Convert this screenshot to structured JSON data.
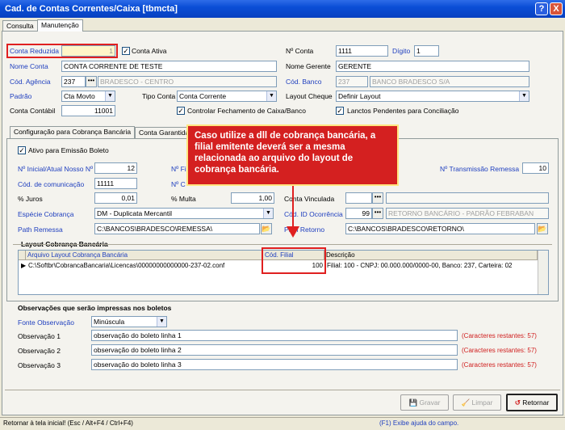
{
  "window": {
    "title": "Cad. de Contas Correntes/Caixa [tbmcta]",
    "help": "?",
    "close": "X"
  },
  "tabs": [
    "Consulta",
    "Manutenção"
  ],
  "form": {
    "conta_reduzida": {
      "label": "Conta Reduzida",
      "value": "1"
    },
    "conta_ativa": {
      "label": "Conta Ativa",
      "checked": true
    },
    "num_conta": {
      "label": "Nº Conta",
      "value": "1111"
    },
    "digito": {
      "label": "Dígito",
      "value": "1"
    },
    "nome_conta": {
      "label": "Nome Conta",
      "value": "CONTA CORRENTE DE TESTE"
    },
    "nome_gerente": {
      "label": "Nome Gerente",
      "value": "GERENTE"
    },
    "cod_agencia": {
      "label": "Cód. Agência",
      "value": "237",
      "desc": "BRADESCO - CENTRO"
    },
    "cod_banco": {
      "label": "Cód. Banco",
      "value": "237",
      "desc": "BANCO BRADESCO S/A"
    },
    "padrao": {
      "label": "Padrão",
      "value": "Cta Movto"
    },
    "tipo_conta": {
      "label": "Tipo Conta",
      "value": "Conta Corrente"
    },
    "layout_cheque": {
      "label": "Layout Cheque",
      "value": "Definir Layout"
    },
    "conta_contabil": {
      "label": "Conta Contábil",
      "value": "11001"
    },
    "controlar_fechamento": {
      "label": "Controlar Fechamento de Caixa/Banco",
      "checked": true
    },
    "lanctos_pendentes": {
      "label": "Lanctos Pendentes para Conciliação",
      "checked": true
    }
  },
  "subtabs": [
    "Configuração para Cobrança Bancária",
    "Conta Garantida"
  ],
  "cobranca": {
    "ativo_label": "Ativo para Emissão Boleto",
    "nosso_numero": {
      "label": "Nº Inicial/Atual Nosso Nº",
      "value": "12"
    },
    "nf_label": "Nº Fi",
    "nc_label": "Nº C",
    "transmissao": {
      "label": "Nº Transmissão Remessa",
      "value": "10"
    },
    "cod_comunicacao": {
      "label": "Cód. de comunicação",
      "value": "11111"
    },
    "juros": {
      "label": "% Juros",
      "value": "0,01"
    },
    "multa": {
      "label": "% Multa",
      "value": "1,00"
    },
    "conta_vinculada": {
      "label": "Conta Vinculada"
    },
    "especie": {
      "label": "Espécie Cobrança",
      "value": "DM - Duplicata Mercantil"
    },
    "cod_ocorrencia": {
      "label": "Cód. ID Ocorrência",
      "value": "99",
      "desc": "RETORNO BANCÁRIO - PADRÃO FEBRABAN"
    },
    "path_remessa": {
      "label": "Path Remessa",
      "value": "C:\\BANCOS\\BRADESCO\\REMESSA\\"
    },
    "path_retorno": {
      "label": "Path Retorno",
      "value": "C:\\BANCOS\\BRADESCO\\RETORNO\\"
    }
  },
  "callout": "Caso utilize a dll de cobrança bancária, a filial emitente deverá ser a mesma relacionada ao arquivo do layout de cobrança bancária.",
  "layout_section": {
    "title": "Layout Cobrança Bancária",
    "columns": [
      "Arquivo Layout Cobrança Bancária",
      "Cód. Filial",
      "Descrição"
    ],
    "rows": [
      {
        "arquivo": "C:\\Softbr\\CobrancaBancaria\\Licencas\\00000000000000-237-02.conf",
        "filial": "100",
        "descricao": "Filial: 100 - CNPJ: 00.000.000/0000-00, Banco: 237, Carteira: 02"
      }
    ]
  },
  "obs_section": {
    "title": "Observações que serão impressas nos boletos",
    "fonte": {
      "label": "Fonte Observação",
      "value": "Minúscula"
    },
    "lines": [
      {
        "label": "Observação 1",
        "value": "observação do boleto linha 1",
        "rest": "(Caracteres restantes: 57)"
      },
      {
        "label": "Observação 2",
        "value": "observação do boleto linha 2",
        "rest": "(Caracteres restantes: 57)"
      },
      {
        "label": "Observação 3",
        "value": "observação do boleto linha 3",
        "rest": "(Caracteres restantes: 57)"
      }
    ]
  },
  "buttons": {
    "gravar": "Gravar",
    "limpar": "Limpar",
    "retornar": "Retornar"
  },
  "status": {
    "left": "Retornar à tela inicial! (Esc / Alt+F4 / Ctrl+F4)",
    "right": "(F1) Exibe ajuda do campo."
  },
  "colors": {
    "accent_red": "#E02020",
    "label_blue": "#1F3FBF",
    "titlebar": "#0A4ED6"
  }
}
